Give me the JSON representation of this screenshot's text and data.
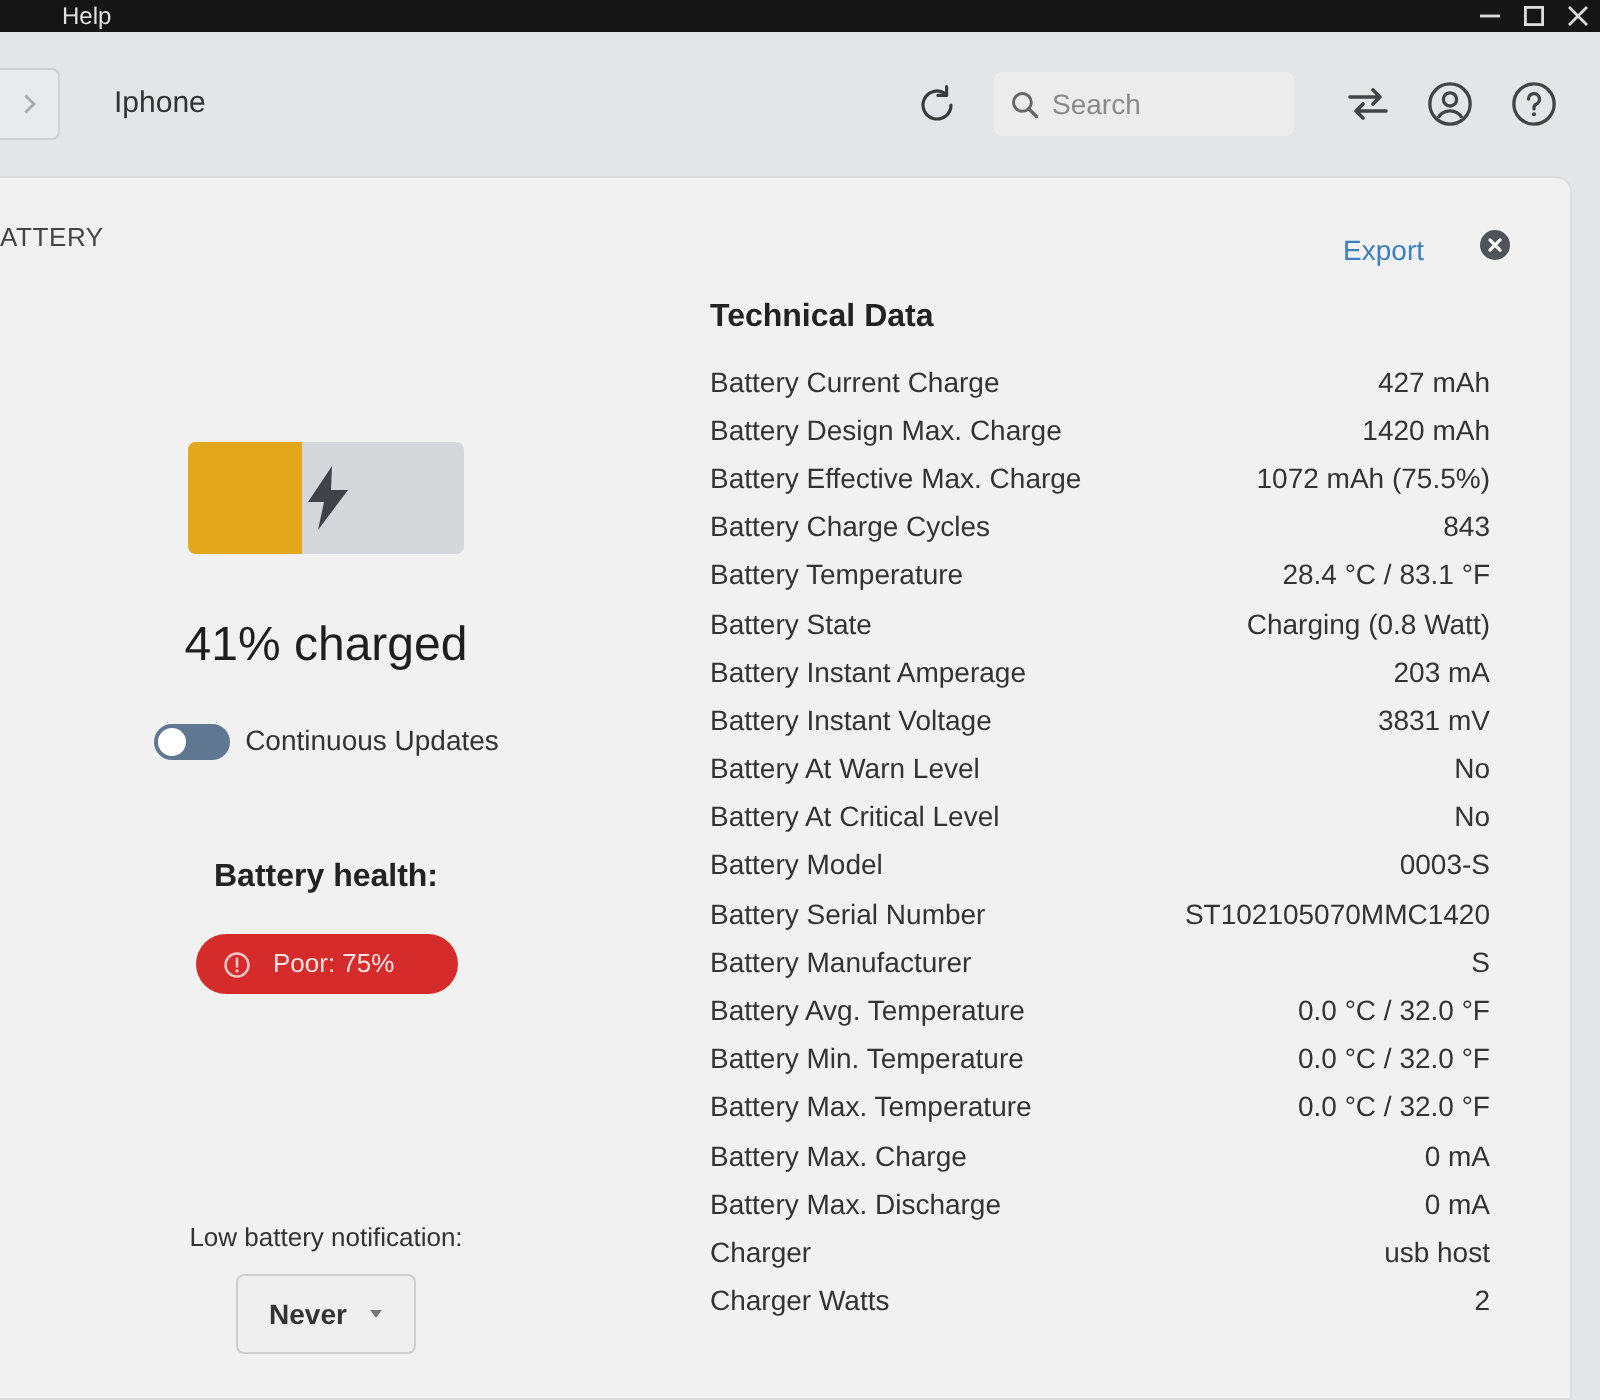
{
  "menu_bar": [
    "Help"
  ],
  "header": {
    "device": "Iphone",
    "search": {
      "placeholder": "Search"
    }
  },
  "section": {
    "title": "ATTERY"
  },
  "panel": {
    "export": "Export"
  },
  "battery": {
    "level": 0.41,
    "charging": true,
    "status": "41% charged"
  },
  "continuous_updates": {
    "label": "Continuous Updates",
    "on": false
  },
  "health": {
    "label": "Battery health:",
    "badge": "Poor: 75%"
  },
  "notification": {
    "label": "Low battery notification:",
    "value": "Never"
  },
  "technical_data": {
    "title": "Technical Data",
    "rows": [
      {
        "label": "Battery Current Charge",
        "value": "427 mAh"
      },
      {
        "label": "Battery Design Max. Charge",
        "value": "1420 mAh"
      },
      {
        "label": "Battery Effective Max. Charge",
        "value": "1072 mAh (75.5%)"
      },
      {
        "label": "Battery Charge Cycles",
        "value": "843"
      },
      {
        "label": "Battery Temperature",
        "value": "28.4 °C / 83.1 °F"
      },
      {
        "label": "Battery State",
        "value": "Charging (0.8 Watt)"
      },
      {
        "label": "Battery Instant Amperage",
        "value": "203 mA"
      },
      {
        "label": "Battery Instant Voltage",
        "value": "3831 mV"
      },
      {
        "label": "Battery At Warn Level",
        "value": "No"
      },
      {
        "label": "Battery At Critical Level",
        "value": "No"
      },
      {
        "label": "Battery Model",
        "value": "0003-S"
      },
      {
        "label": "Battery Serial Number",
        "value": "ST102105070MMC1420"
      },
      {
        "label": "Battery Manufacturer",
        "value": "S"
      },
      {
        "label": "Battery Avg. Temperature",
        "value": "0.0 °C / 32.0 °F"
      },
      {
        "label": "Battery Min. Temperature",
        "value": "0.0 °C / 32.0 °F"
      },
      {
        "label": "Battery Max. Temperature",
        "value": "0.0 °C / 32.0 °F"
      },
      {
        "label": "Battery Max. Charge",
        "value": "0 mA"
      },
      {
        "label": "Battery Max. Discharge",
        "value": "0 mA"
      },
      {
        "label": "Charger",
        "value": "usb host"
      },
      {
        "label": "Charger Watts",
        "value": "2"
      }
    ]
  }
}
